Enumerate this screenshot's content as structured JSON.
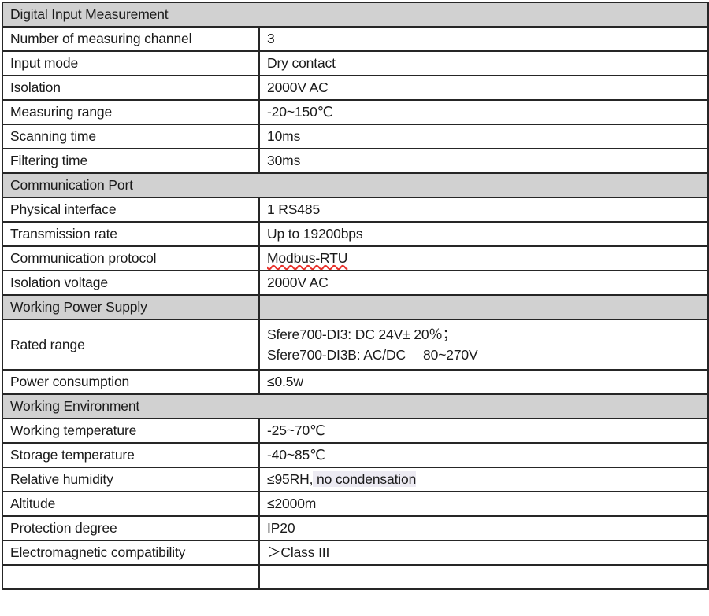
{
  "document": {
    "type": "specification-table",
    "truncated_at_bottom": true,
    "colors": {
      "section_header_background": "#d1d1d1",
      "row_background": "#ffffff",
      "border": "#262626",
      "text": "#1a1a1a",
      "spellcheck_underline": "#e8302a",
      "text_highlight": "#eceaf2"
    }
  },
  "sections": [
    {
      "title": "Digital Input Measurement",
      "header_merged": true,
      "rows": [
        {
          "label": "Number of measuring channel",
          "value": "3"
        },
        {
          "label": "Input mode",
          "value": "Dry contact"
        },
        {
          "label": "Isolation",
          "value": "2000V AC"
        },
        {
          "label": "Measuring range",
          "value": "-20~150℃"
        },
        {
          "label": "Scanning time",
          "value": "10ms"
        },
        {
          "label": "Filtering time",
          "value": "30ms"
        }
      ]
    },
    {
      "title": "Communication Port",
      "header_merged": true,
      "rows": [
        {
          "label": "Physical interface",
          "value": "1 RS485"
        },
        {
          "label": "Transmission rate",
          "value": "Up to 19200bps"
        },
        {
          "label": "Communication protocol",
          "value": "Modbus-RTU",
          "spellcheck_flagged": true
        },
        {
          "label": "Isolation voltage",
          "value": "2000V AC"
        }
      ]
    },
    {
      "title": "Working Power Supply",
      "header_merged": false,
      "header_value": "",
      "rows": [
        {
          "label": "Rated range",
          "value_lines": [
            "Sfere700-DI3: DC 24V± 20％；",
            "Sfere700-DI3B: AC/DC  80~270V"
          ]
        },
        {
          "label": "Power consumption",
          "value": "≤0.5w"
        }
      ]
    },
    {
      "title": "Working Environment",
      "header_merged": true,
      "rows": [
        {
          "label": "Working temperature",
          "value": "-25~70℃"
        },
        {
          "label": "Storage temperature",
          "value": "-40~85℃"
        },
        {
          "label": "Relative humidity",
          "value_prefix": "≤95RH,",
          "value_highlighted": " no condensation"
        },
        {
          "label": "Altitude",
          "value": "≤2000m"
        },
        {
          "label": "Protection degree",
          "value": "IP20"
        },
        {
          "label": "Electromagnetic compatibility",
          "value": "＞Class III"
        }
      ]
    }
  ]
}
